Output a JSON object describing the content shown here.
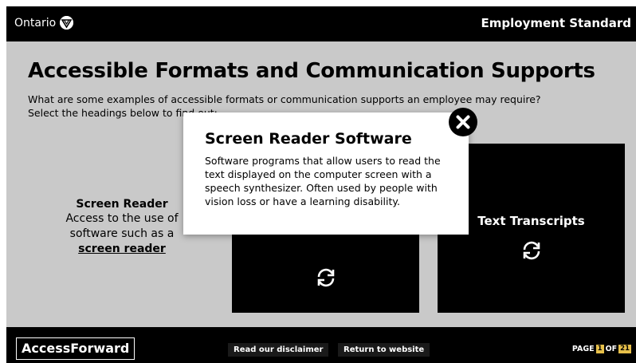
{
  "header": {
    "logo_text": "Ontario",
    "title": "Employment Standard"
  },
  "main": {
    "heading": "Accessible Formats and Communication Supports",
    "intro_line1": "What are some examples of accessible formats or communication supports an employee may require?",
    "intro_line2": "Select the headings below to find out:"
  },
  "cards": {
    "left": {
      "title": "Screen Reader",
      "desc1": "Access to the use of",
      "desc2": "software such as a",
      "link": "screen reader"
    },
    "right": {
      "title": "Text Transcripts"
    }
  },
  "modal": {
    "title": "Screen Reader Software",
    "body": "Software programs that allow users to read the text displayed on the computer screen with a speech synthesizer. Often used by people with vision loss or have a learning disability."
  },
  "footer": {
    "brand": "AccessForward",
    "disclaimer_label": "Read our disclaimer",
    "return_label": "Return to website",
    "page_prefix": "PAGE",
    "page_current": "1",
    "page_of": "OF",
    "page_total": "21"
  },
  "colors": {
    "bar": "#000000",
    "content_bg": "#c9c9c9",
    "card": "#000000",
    "page_highlight": "#e7c04a"
  },
  "icons": [
    "ontario-trillium-icon",
    "close-icon",
    "flip-arrows-icon"
  ]
}
